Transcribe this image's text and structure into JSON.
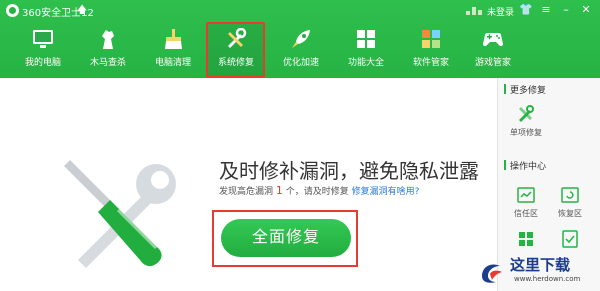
{
  "app": {
    "title": "360安全卫士12",
    "login_label": "未登录"
  },
  "toolbar": {
    "items": [
      {
        "label": "我的电脑",
        "icon": "monitor-icon"
      },
      {
        "label": "木马查杀",
        "icon": "horse-icon"
      },
      {
        "label": "电脑清理",
        "icon": "broom-icon"
      },
      {
        "label": "系统修复",
        "icon": "wrench-icon",
        "active": true
      },
      {
        "label": "优化加速",
        "icon": "rocket-icon"
      },
      {
        "label": "功能大全",
        "icon": "grid-icon"
      },
      {
        "label": "软件管家",
        "icon": "software-icon"
      },
      {
        "label": "游戏管家",
        "icon": "gamepad-icon"
      }
    ]
  },
  "main": {
    "headline": "及时修补漏洞，避免隐私泄露",
    "detail_prefix": "发现高危漏洞",
    "detail_count": "1",
    "detail_suffix": "个，请及时修复",
    "detail_link": "修复漏洞有啥用?",
    "fix_button": "全面修复"
  },
  "side": {
    "more_title": "更多修复",
    "single_fix": "单项修复",
    "ops_title": "操作中心",
    "trust_zone": "信任区",
    "recover_zone": "恢复区"
  },
  "watermark": {
    "text": "这里下载",
    "url": "www.herdown.com"
  },
  "colors": {
    "brand": "#26b344",
    "highlight": "#e83a2e",
    "link": "#2a7bd8"
  }
}
